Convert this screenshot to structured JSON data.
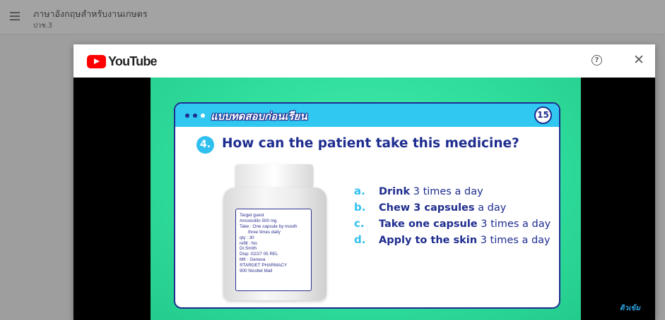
{
  "app": {
    "course_title": "ภาษาอังกฤษสำหรับงานเกษตร",
    "course_subtitle": "ปวช.3"
  },
  "modal": {
    "brand": "YouTube",
    "help_icon": "help-circle-icon",
    "help_glyph": "?",
    "close_icon": "close-icon",
    "close_glyph": "✕"
  },
  "slide": {
    "header_title": "แบบทดสอบก่อนเรียน",
    "slide_number": "15",
    "question_number": "4.",
    "question": "How can the patient take this medicine?",
    "bottle_label": {
      "lines": [
        "Target guest",
        "Amoxicillin 500 mg",
        "Take : One capsule by mouth",
        "three times daily",
        "qty : 30",
        "refill : No",
        "Dr.Smith",
        "Disp :02/27 05 REL",
        "Mfr : Geneva",
        "®TARGET PHARMACY",
        "900 Nicollet Mall"
      ]
    },
    "answers": [
      {
        "letter": "a.",
        "bold": "Drink",
        "rest": " 3 times a day"
      },
      {
        "letter": "b.",
        "bold": "Chew 3 capsules",
        "rest": " a day"
      },
      {
        "letter": "c.",
        "bold": "Take one capsule",
        "rest": " 3 times a day"
      },
      {
        "letter": "d.",
        "bold": "Apply to the skin",
        "rest": " 3 times a day"
      }
    ],
    "watermark": "ติวเข้ม"
  },
  "colors": {
    "slide_green": "#30dd9c",
    "header_blue": "#30c8f0",
    "navy": "#1e2d8f",
    "youtube_red": "#ff0000"
  }
}
